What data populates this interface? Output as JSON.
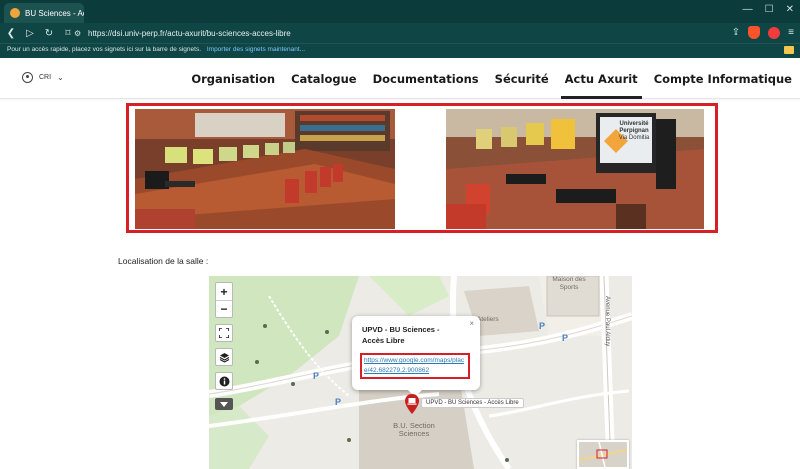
{
  "browser": {
    "tab_title": "BU Sciences - Accès Lib",
    "url": "https://dsi.univ-perp.fr/actu-axurit/bu-sciences-acces-libre",
    "bookmarks_prompt": "Pour un accès rapide, placez vos signets ici sur la barre de signets.",
    "bookmarks_import": "Importer des signets maintenant..."
  },
  "header": {
    "user_label": "CRI",
    "nav": [
      {
        "label": "Organisation"
      },
      {
        "label": "Catalogue"
      },
      {
        "label": "Documentations"
      },
      {
        "label": "Sécurité"
      },
      {
        "label": "Actu Axurit",
        "active": true
      },
      {
        "label": "Compte Informatique"
      }
    ]
  },
  "photos": {
    "banner_line1": "Université",
    "banner_line2": "Perpignan",
    "banner_line3": "Via Domitia"
  },
  "content": {
    "location_label": "Localisation de la salle :"
  },
  "map": {
    "zoom_in": "+",
    "zoom_out": "−",
    "popup_title": "UPVD - BU Sciences - Accès Libre",
    "popup_close": "×",
    "popup_link": "https://www.google.com/maps/place/42.682279,2.900862",
    "marker_label": "UPVD - BU Sciences - Accès Libre",
    "building_label": "B.U. Section Sciences",
    "ateliers_label": "Ateliers",
    "sports_label": "Maison des Sports",
    "road_label": "Avenue Paul Alduy",
    "parking": "P"
  },
  "colors": {
    "tabbar": "#0b3b3a",
    "highlight_red": "#d61f26",
    "link": "#2a7ab5"
  }
}
